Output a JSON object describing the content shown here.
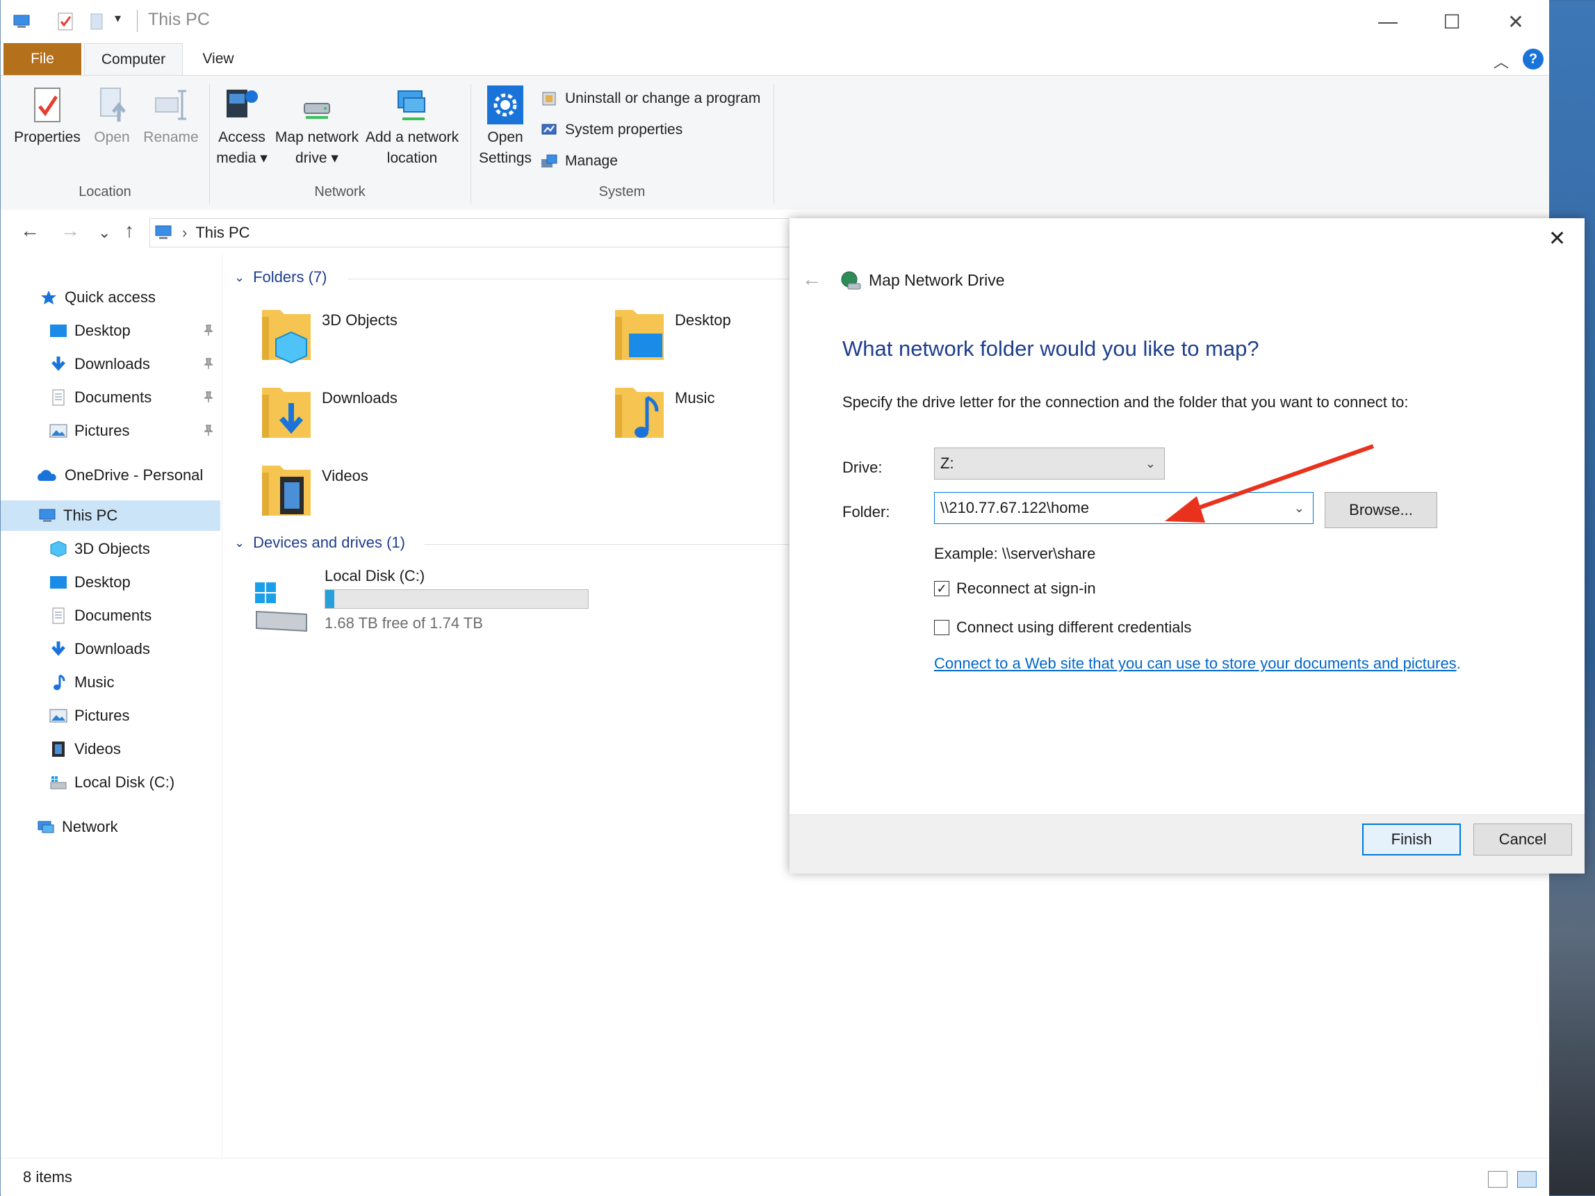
{
  "window": {
    "title": "This PC",
    "minimize_glyph": "—",
    "maximize_glyph": "☐",
    "close_glyph": "✕"
  },
  "ribbon": {
    "tabs": [
      {
        "label": "File"
      },
      {
        "label": "Computer"
      },
      {
        "label": "View"
      }
    ],
    "location": {
      "group_label": "Location",
      "properties": "Properties",
      "open": "Open",
      "rename": "Rename"
    },
    "network": {
      "group_label": "Network",
      "access_media_1": "Access",
      "access_media_2": "media",
      "map_drive_1": "Map network",
      "map_drive_2": "drive",
      "add_location_1": "Add a network",
      "add_location_2": "location"
    },
    "system": {
      "group_label": "System",
      "open_settings_1": "Open",
      "open_settings_2": "Settings",
      "uninstall": "Uninstall or change a program",
      "system_properties": "System properties",
      "manage": "Manage"
    }
  },
  "nav": {
    "back": "←",
    "forward": "→",
    "recent": "⌄",
    "up": "↑",
    "breadcrumb": "This PC",
    "chevron": "›"
  },
  "sidebar": {
    "quick_access": "Quick access",
    "quick_items": [
      {
        "label": "Desktop"
      },
      {
        "label": "Downloads"
      },
      {
        "label": "Documents"
      },
      {
        "label": "Pictures"
      }
    ],
    "onedrive": "OneDrive - Personal",
    "this_pc": "This PC",
    "pc_items": [
      {
        "label": "3D Objects"
      },
      {
        "label": "Desktop"
      },
      {
        "label": "Documents"
      },
      {
        "label": "Downloads"
      },
      {
        "label": "Music"
      },
      {
        "label": "Pictures"
      },
      {
        "label": "Videos"
      },
      {
        "label": "Local Disk (C:)"
      }
    ],
    "network": "Network"
  },
  "content": {
    "folders_header": "Folders (7)",
    "folders": [
      {
        "label": "3D Objects"
      },
      {
        "label": "Desktop"
      },
      {
        "label": "Downloads"
      },
      {
        "label": "Music"
      },
      {
        "label": "Videos"
      }
    ],
    "drives_header": "Devices and drives (1)",
    "drive": {
      "name": "Local Disk (C:)",
      "free_text": "1.68 TB free of 1.74 TB",
      "used_fraction": 0.034
    }
  },
  "status": {
    "items": "8 items"
  },
  "dialog": {
    "title": "Map Network Drive",
    "heading": "What network folder would you like to map?",
    "instructions": "Specify the drive letter for the connection and the folder that you want to connect to:",
    "drive_label": "Drive:",
    "drive_value": "Z:",
    "folder_label": "Folder:",
    "folder_value": "\\\\210.77.67.122\\home",
    "browse": "Browse...",
    "example": "Example: \\\\server\\share",
    "reconnect_label": "Reconnect at sign-in",
    "reconnect_checked": true,
    "credentials_label": "Connect using different credentials",
    "credentials_checked": false,
    "link_text": "Connect to a Web site that you can use to store your documents and pictures",
    "finish": "Finish",
    "cancel": "Cancel",
    "back_glyph": "←",
    "close_glyph": "✕"
  },
  "colors": {
    "file_tab": "#b4701b",
    "heading_blue": "#1e3e8c",
    "link_blue": "#0066cc",
    "annotation_arrow": "#e8321e",
    "folder_yellow": "#f5c451"
  }
}
